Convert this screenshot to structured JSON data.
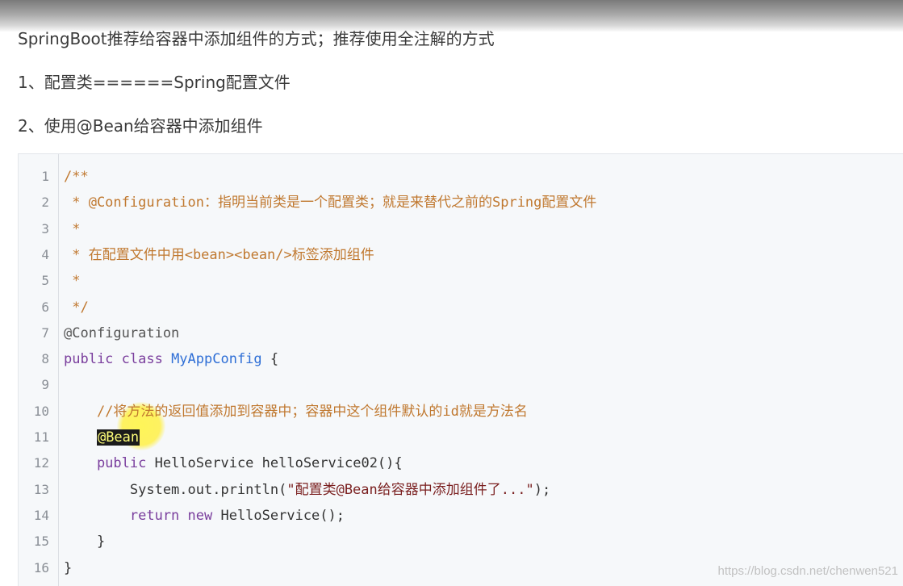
{
  "article": {
    "paragraphs": [
      "SpringBoot推荐给容器中添加组件的方式；推荐使用全注解的方式",
      "1、配置类======Spring配置文件",
      "2、使用@Bean给容器中添加组件"
    ]
  },
  "code": {
    "lines": [
      {
        "n": "1",
        "segments": [
          {
            "t": "/**",
            "k": "comment"
          }
        ]
      },
      {
        "n": "2",
        "segments": [
          {
            "t": " * @Configuration：指明当前类是一个配置类；就是来替代之前的Spring配置文件",
            "k": "comment"
          }
        ]
      },
      {
        "n": "3",
        "segments": [
          {
            "t": " *",
            "k": "comment"
          }
        ]
      },
      {
        "n": "4",
        "segments": [
          {
            "t": " * 在配置文件中用<bean><bean/>标签添加组件",
            "k": "comment"
          }
        ]
      },
      {
        "n": "5",
        "segments": [
          {
            "t": " *",
            "k": "comment"
          }
        ]
      },
      {
        "n": "6",
        "segments": [
          {
            "t": " */",
            "k": "comment"
          }
        ]
      },
      {
        "n": "7",
        "segments": [
          {
            "t": "@Configuration",
            "k": "annot"
          }
        ]
      },
      {
        "n": "8",
        "segments": [
          {
            "t": "public class ",
            "k": "keyword"
          },
          {
            "t": "MyAppConfig",
            "k": "type"
          },
          {
            "t": " {",
            "k": "plain"
          }
        ]
      },
      {
        "n": "9",
        "segments": []
      },
      {
        "n": "10",
        "segments": [
          {
            "t": "    //将方法的返回值添加到容器中；容器中这个组件默认的id就是方法名",
            "k": "comment"
          }
        ]
      },
      {
        "n": "11",
        "segments": [
          {
            "t": "    ",
            "k": "plain"
          },
          {
            "t": "@Bean",
            "k": "highlight"
          }
        ]
      },
      {
        "n": "12",
        "segments": [
          {
            "t": "    public ",
            "k": "keyword"
          },
          {
            "t": "HelloService helloService02(){",
            "k": "plain"
          }
        ]
      },
      {
        "n": "13",
        "segments": [
          {
            "t": "        System.out.println(",
            "k": "plain"
          },
          {
            "t": "\"配置类@Bean给容器中添加组件了...\"",
            "k": "string"
          },
          {
            "t": ");",
            "k": "plain"
          }
        ]
      },
      {
        "n": "14",
        "segments": [
          {
            "t": "        return new ",
            "k": "keyword"
          },
          {
            "t": "HelloService();",
            "k": "plain"
          }
        ]
      },
      {
        "n": "15",
        "segments": [
          {
            "t": "    }",
            "k": "plain"
          }
        ]
      },
      {
        "n": "16",
        "segments": [
          {
            "t": "}",
            "k": "plain"
          }
        ]
      }
    ]
  },
  "watermark": "https://blog.csdn.net/chenwen521",
  "colors": {
    "comment": "#c0782f",
    "keyword": "#7a3e9d",
    "type": "#2f6fd6",
    "string": "#7a1f1f",
    "code_background": "#f6f8fa",
    "cursor_highlight": "#fff550"
  }
}
